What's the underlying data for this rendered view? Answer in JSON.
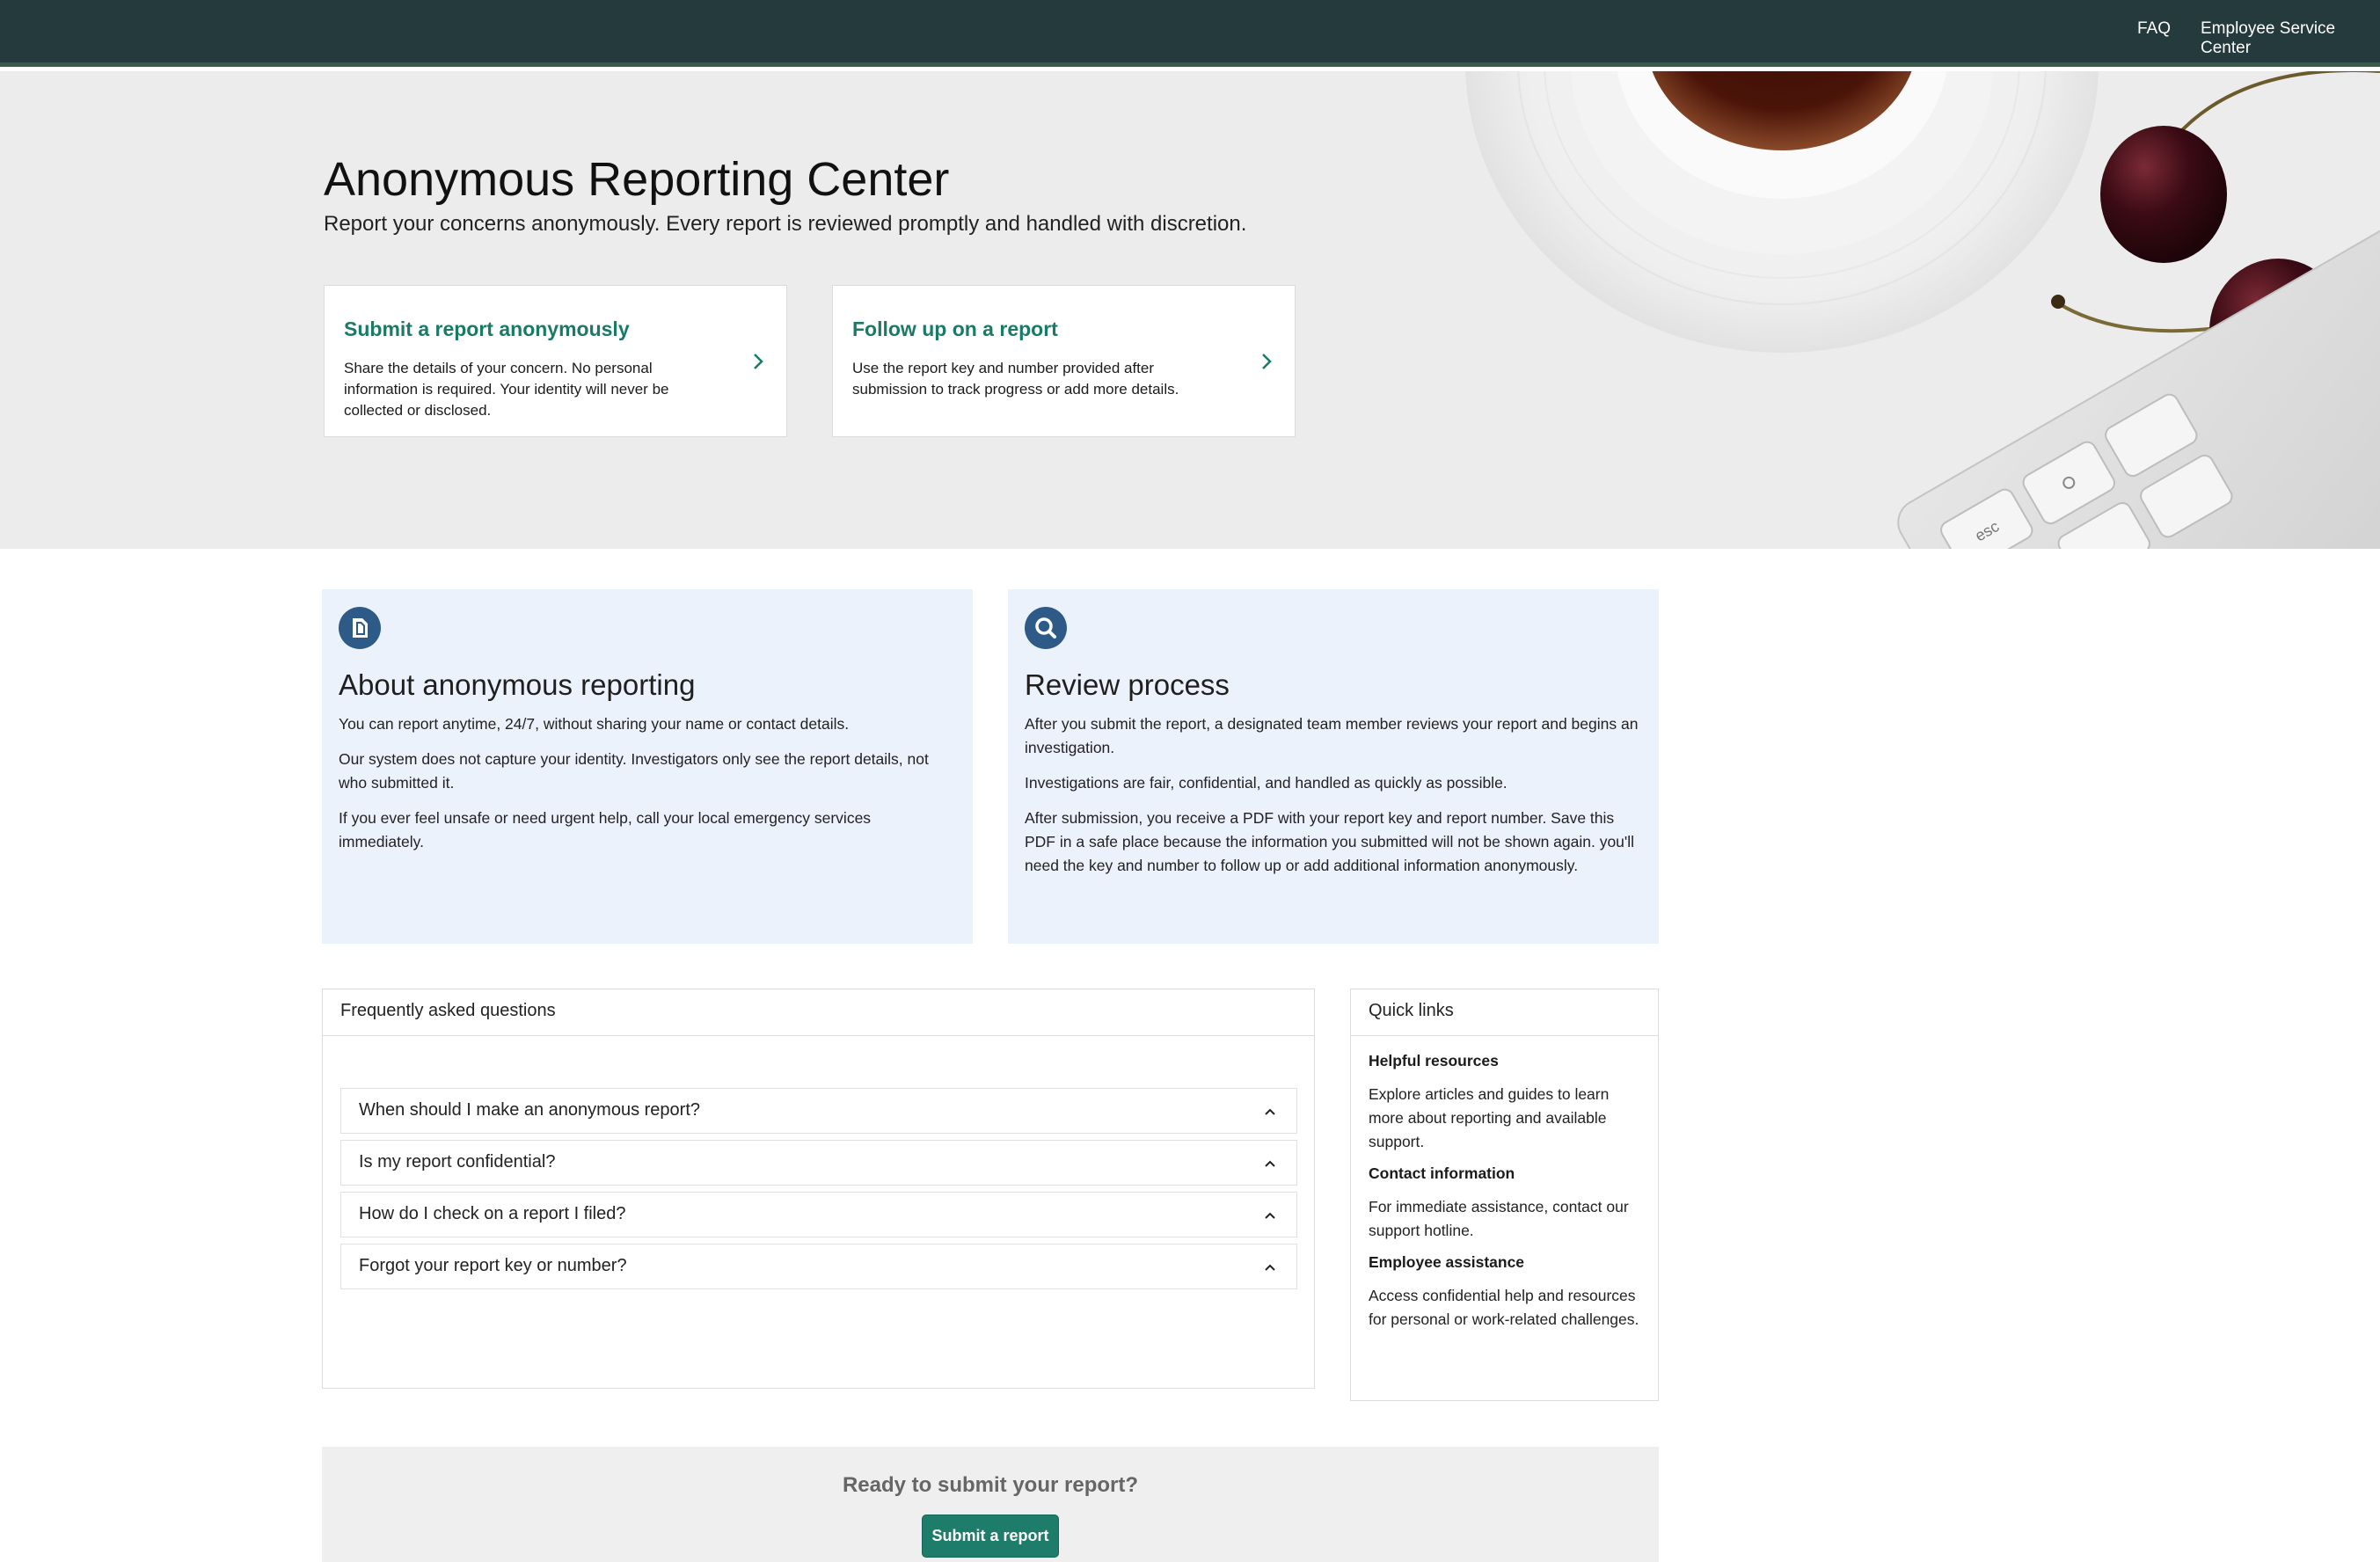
{
  "nav": {
    "faq_label": "FAQ",
    "esc_label": "Employee Service Center"
  },
  "hero": {
    "title": "Anonymous Reporting Center",
    "subtitle": "Report your concerns anonymously. Every report is reviewed promptly and handled with discretion.",
    "cards": [
      {
        "title": "Submit a report anonymously",
        "description": "Share the details of your concern. No personal information is required. Your identity will never be collected or disclosed."
      },
      {
        "title": "Follow up on a report",
        "description": "Use the report key and number provided after submission to track progress or add more details."
      }
    ],
    "keyboard_keys": {
      "esc": "esc",
      "tilde": "~"
    }
  },
  "panels": {
    "about": {
      "icon": "document-icon",
      "title": "About anonymous reporting",
      "paragraphs": [
        "You can report anytime, 24/7, without sharing your name or contact details.",
        "Our system does not capture your identity. Investigators only see the report details, not who submitted it.",
        "If you ever feel unsafe or need urgent help, call your local emergency services immediately."
      ]
    },
    "review": {
      "icon": "search-icon",
      "title": "Review process",
      "paragraphs": [
        "After you submit the report, a designated team member reviews your report and begins an investigation.",
        "Investigations are fair, confidential, and handled as quickly as possible.",
        "After submission, you receive a PDF with your report key and report number. Save this PDF in a safe place because the information you submitted will not be shown again. you'll need the key and number to follow up or add additional information anonymously."
      ]
    }
  },
  "faq": {
    "heading": "Frequently asked questions",
    "items": [
      "When should I make an anonymous report?",
      "Is my report confidential?",
      "How do I check on a report I filed?",
      "Forgot your report key or number?"
    ]
  },
  "quick_links": {
    "heading": "Quick links",
    "sections": [
      {
        "title": "Helpful resources",
        "text": "Explore articles and guides to learn more about reporting and available support."
      },
      {
        "title": "Contact information",
        "text": "For immediate assistance, contact our support hotline."
      },
      {
        "title": "Employee assistance",
        "text": "Access confidential help and resources for personal or work-related challenges."
      }
    ]
  },
  "cta": {
    "title": "Ready to submit your report?",
    "button_label": "Submit a report"
  },
  "colors": {
    "nav_bg": "#243a3d",
    "accent": "#1e7c6a",
    "icon_circle": "#2d5a87",
    "panel_bg": "#ecf2fb"
  }
}
